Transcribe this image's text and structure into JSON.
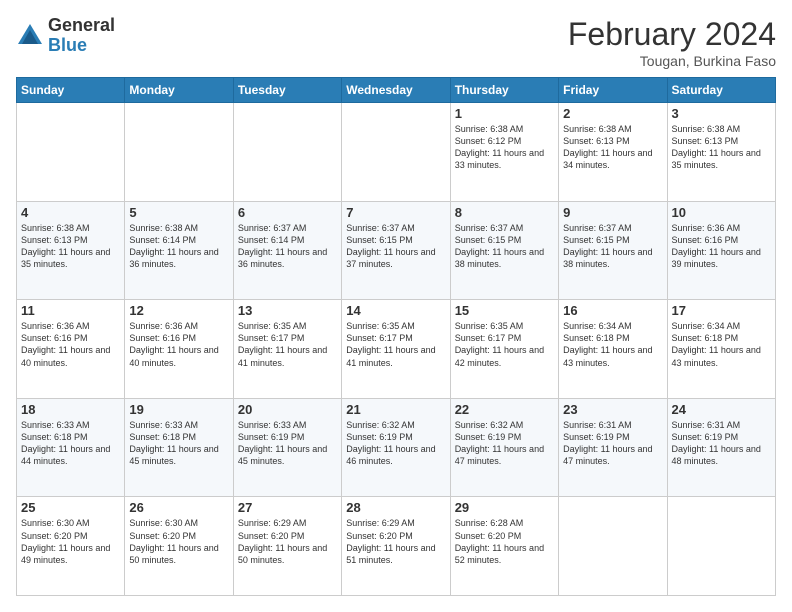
{
  "header": {
    "logo_general": "General",
    "logo_blue": "Blue",
    "title": "February 2024",
    "subtitle": "Tougan, Burkina Faso"
  },
  "days_of_week": [
    "Sunday",
    "Monday",
    "Tuesday",
    "Wednesday",
    "Thursday",
    "Friday",
    "Saturday"
  ],
  "weeks": [
    [
      {
        "day": "",
        "info": ""
      },
      {
        "day": "",
        "info": ""
      },
      {
        "day": "",
        "info": ""
      },
      {
        "day": "",
        "info": ""
      },
      {
        "day": "1",
        "info": "Sunrise: 6:38 AM\nSunset: 6:12 PM\nDaylight: 11 hours\nand 33 minutes."
      },
      {
        "day": "2",
        "info": "Sunrise: 6:38 AM\nSunset: 6:13 PM\nDaylight: 11 hours\nand 34 minutes."
      },
      {
        "day": "3",
        "info": "Sunrise: 6:38 AM\nSunset: 6:13 PM\nDaylight: 11 hours\nand 35 minutes."
      }
    ],
    [
      {
        "day": "4",
        "info": "Sunrise: 6:38 AM\nSunset: 6:13 PM\nDaylight: 11 hours\nand 35 minutes."
      },
      {
        "day": "5",
        "info": "Sunrise: 6:38 AM\nSunset: 6:14 PM\nDaylight: 11 hours\nand 36 minutes."
      },
      {
        "day": "6",
        "info": "Sunrise: 6:37 AM\nSunset: 6:14 PM\nDaylight: 11 hours\nand 36 minutes."
      },
      {
        "day": "7",
        "info": "Sunrise: 6:37 AM\nSunset: 6:15 PM\nDaylight: 11 hours\nand 37 minutes."
      },
      {
        "day": "8",
        "info": "Sunrise: 6:37 AM\nSunset: 6:15 PM\nDaylight: 11 hours\nand 38 minutes."
      },
      {
        "day": "9",
        "info": "Sunrise: 6:37 AM\nSunset: 6:15 PM\nDaylight: 11 hours\nand 38 minutes."
      },
      {
        "day": "10",
        "info": "Sunrise: 6:36 AM\nSunset: 6:16 PM\nDaylight: 11 hours\nand 39 minutes."
      }
    ],
    [
      {
        "day": "11",
        "info": "Sunrise: 6:36 AM\nSunset: 6:16 PM\nDaylight: 11 hours\nand 40 minutes."
      },
      {
        "day": "12",
        "info": "Sunrise: 6:36 AM\nSunset: 6:16 PM\nDaylight: 11 hours\nand 40 minutes."
      },
      {
        "day": "13",
        "info": "Sunrise: 6:35 AM\nSunset: 6:17 PM\nDaylight: 11 hours\nand 41 minutes."
      },
      {
        "day": "14",
        "info": "Sunrise: 6:35 AM\nSunset: 6:17 PM\nDaylight: 11 hours\nand 41 minutes."
      },
      {
        "day": "15",
        "info": "Sunrise: 6:35 AM\nSunset: 6:17 PM\nDaylight: 11 hours\nand 42 minutes."
      },
      {
        "day": "16",
        "info": "Sunrise: 6:34 AM\nSunset: 6:18 PM\nDaylight: 11 hours\nand 43 minutes."
      },
      {
        "day": "17",
        "info": "Sunrise: 6:34 AM\nSunset: 6:18 PM\nDaylight: 11 hours\nand 43 minutes."
      }
    ],
    [
      {
        "day": "18",
        "info": "Sunrise: 6:33 AM\nSunset: 6:18 PM\nDaylight: 11 hours\nand 44 minutes."
      },
      {
        "day": "19",
        "info": "Sunrise: 6:33 AM\nSunset: 6:18 PM\nDaylight: 11 hours\nand 45 minutes."
      },
      {
        "day": "20",
        "info": "Sunrise: 6:33 AM\nSunset: 6:19 PM\nDaylight: 11 hours\nand 45 minutes."
      },
      {
        "day": "21",
        "info": "Sunrise: 6:32 AM\nSunset: 6:19 PM\nDaylight: 11 hours\nand 46 minutes."
      },
      {
        "day": "22",
        "info": "Sunrise: 6:32 AM\nSunset: 6:19 PM\nDaylight: 11 hours\nand 47 minutes."
      },
      {
        "day": "23",
        "info": "Sunrise: 6:31 AM\nSunset: 6:19 PM\nDaylight: 11 hours\nand 47 minutes."
      },
      {
        "day": "24",
        "info": "Sunrise: 6:31 AM\nSunset: 6:19 PM\nDaylight: 11 hours\nand 48 minutes."
      }
    ],
    [
      {
        "day": "25",
        "info": "Sunrise: 6:30 AM\nSunset: 6:20 PM\nDaylight: 11 hours\nand 49 minutes."
      },
      {
        "day": "26",
        "info": "Sunrise: 6:30 AM\nSunset: 6:20 PM\nDaylight: 11 hours\nand 50 minutes."
      },
      {
        "day": "27",
        "info": "Sunrise: 6:29 AM\nSunset: 6:20 PM\nDaylight: 11 hours\nand 50 minutes."
      },
      {
        "day": "28",
        "info": "Sunrise: 6:29 AM\nSunset: 6:20 PM\nDaylight: 11 hours\nand 51 minutes."
      },
      {
        "day": "29",
        "info": "Sunrise: 6:28 AM\nSunset: 6:20 PM\nDaylight: 11 hours\nand 52 minutes."
      },
      {
        "day": "",
        "info": ""
      },
      {
        "day": "",
        "info": ""
      }
    ]
  ]
}
